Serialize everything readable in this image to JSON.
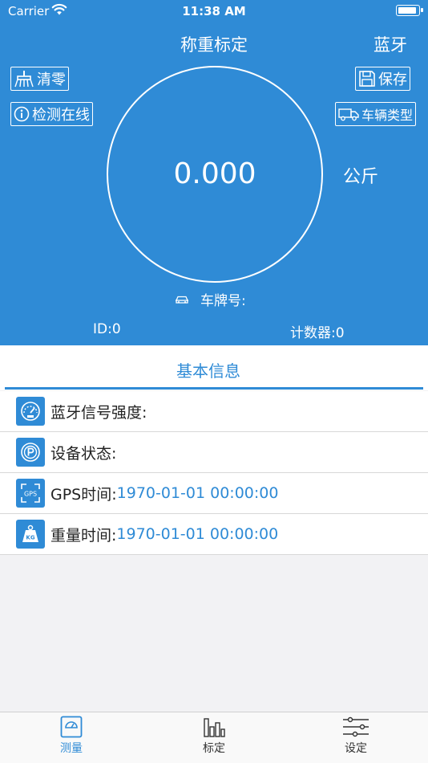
{
  "status_bar": {
    "carrier": "Carrier",
    "time": "11:38 AM",
    "battery_level": 0.95
  },
  "header": {
    "title": "称重标定",
    "bluetooth_label": "蓝牙",
    "clear_label": "清零",
    "save_label": "保存",
    "detect_online_label": "检测在线",
    "vehicle_type_label": "车辆类型",
    "weight_value": "0.000",
    "unit": "公斤",
    "plate_label": "车牌号:",
    "id_label": "ID:0",
    "counter_label": "计数器:0"
  },
  "section": {
    "title": "基本信息"
  },
  "info_rows": [
    {
      "label": "蓝牙信号强度:",
      "value": "",
      "icon": "speedometer-icon"
    },
    {
      "label": "设备状态:",
      "value": "",
      "icon": "parking-icon"
    },
    {
      "label": "GPS时间:",
      "value": "1970-01-01 00:00:00",
      "icon": "gps-icon"
    },
    {
      "label": "重量时间:",
      "value": "1970-01-01 00:00:00",
      "icon": "kg-weight-icon"
    }
  ],
  "tabs": [
    {
      "label": "测量",
      "icon": "scale-icon",
      "active": true
    },
    {
      "label": "标定",
      "icon": "bar-chart-icon",
      "active": false
    },
    {
      "label": "设定",
      "icon": "sliders-icon",
      "active": false
    }
  ],
  "colors": {
    "primary": "#2f8bd6",
    "background": "#f2f2f4",
    "text": "#222222"
  }
}
